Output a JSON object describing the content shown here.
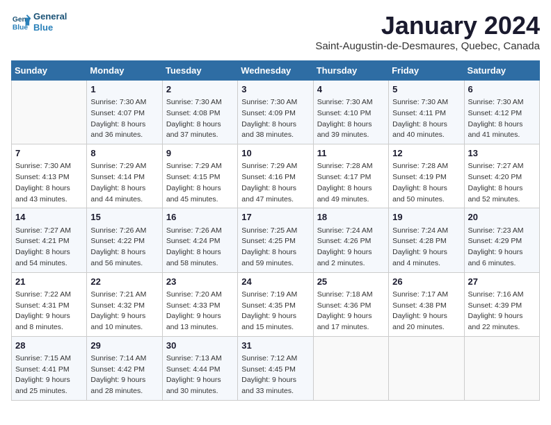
{
  "header": {
    "logo_line1": "General",
    "logo_line2": "Blue",
    "title": "January 2024",
    "subtitle": "Saint-Augustin-de-Desmaures, Quebec, Canada"
  },
  "columns": [
    "Sunday",
    "Monday",
    "Tuesday",
    "Wednesday",
    "Thursday",
    "Friday",
    "Saturday"
  ],
  "weeks": [
    [
      {
        "day": "",
        "sunrise": "",
        "sunset": "",
        "daylight": ""
      },
      {
        "day": "1",
        "sunrise": "Sunrise: 7:30 AM",
        "sunset": "Sunset: 4:07 PM",
        "daylight": "Daylight: 8 hours and 36 minutes."
      },
      {
        "day": "2",
        "sunrise": "Sunrise: 7:30 AM",
        "sunset": "Sunset: 4:08 PM",
        "daylight": "Daylight: 8 hours and 37 minutes."
      },
      {
        "day": "3",
        "sunrise": "Sunrise: 7:30 AM",
        "sunset": "Sunset: 4:09 PM",
        "daylight": "Daylight: 8 hours and 38 minutes."
      },
      {
        "day": "4",
        "sunrise": "Sunrise: 7:30 AM",
        "sunset": "Sunset: 4:10 PM",
        "daylight": "Daylight: 8 hours and 39 minutes."
      },
      {
        "day": "5",
        "sunrise": "Sunrise: 7:30 AM",
        "sunset": "Sunset: 4:11 PM",
        "daylight": "Daylight: 8 hours and 40 minutes."
      },
      {
        "day": "6",
        "sunrise": "Sunrise: 7:30 AM",
        "sunset": "Sunset: 4:12 PM",
        "daylight": "Daylight: 8 hours and 41 minutes."
      }
    ],
    [
      {
        "day": "7",
        "sunrise": "Sunrise: 7:30 AM",
        "sunset": "Sunset: 4:13 PM",
        "daylight": "Daylight: 8 hours and 43 minutes."
      },
      {
        "day": "8",
        "sunrise": "Sunrise: 7:29 AM",
        "sunset": "Sunset: 4:14 PM",
        "daylight": "Daylight: 8 hours and 44 minutes."
      },
      {
        "day": "9",
        "sunrise": "Sunrise: 7:29 AM",
        "sunset": "Sunset: 4:15 PM",
        "daylight": "Daylight: 8 hours and 45 minutes."
      },
      {
        "day": "10",
        "sunrise": "Sunrise: 7:29 AM",
        "sunset": "Sunset: 4:16 PM",
        "daylight": "Daylight: 8 hours and 47 minutes."
      },
      {
        "day": "11",
        "sunrise": "Sunrise: 7:28 AM",
        "sunset": "Sunset: 4:17 PM",
        "daylight": "Daylight: 8 hours and 49 minutes."
      },
      {
        "day": "12",
        "sunrise": "Sunrise: 7:28 AM",
        "sunset": "Sunset: 4:19 PM",
        "daylight": "Daylight: 8 hours and 50 minutes."
      },
      {
        "day": "13",
        "sunrise": "Sunrise: 7:27 AM",
        "sunset": "Sunset: 4:20 PM",
        "daylight": "Daylight: 8 hours and 52 minutes."
      }
    ],
    [
      {
        "day": "14",
        "sunrise": "Sunrise: 7:27 AM",
        "sunset": "Sunset: 4:21 PM",
        "daylight": "Daylight: 8 hours and 54 minutes."
      },
      {
        "day": "15",
        "sunrise": "Sunrise: 7:26 AM",
        "sunset": "Sunset: 4:22 PM",
        "daylight": "Daylight: 8 hours and 56 minutes."
      },
      {
        "day": "16",
        "sunrise": "Sunrise: 7:26 AM",
        "sunset": "Sunset: 4:24 PM",
        "daylight": "Daylight: 8 hours and 58 minutes."
      },
      {
        "day": "17",
        "sunrise": "Sunrise: 7:25 AM",
        "sunset": "Sunset: 4:25 PM",
        "daylight": "Daylight: 8 hours and 59 minutes."
      },
      {
        "day": "18",
        "sunrise": "Sunrise: 7:24 AM",
        "sunset": "Sunset: 4:26 PM",
        "daylight": "Daylight: 9 hours and 2 minutes."
      },
      {
        "day": "19",
        "sunrise": "Sunrise: 7:24 AM",
        "sunset": "Sunset: 4:28 PM",
        "daylight": "Daylight: 9 hours and 4 minutes."
      },
      {
        "day": "20",
        "sunrise": "Sunrise: 7:23 AM",
        "sunset": "Sunset: 4:29 PM",
        "daylight": "Daylight: 9 hours and 6 minutes."
      }
    ],
    [
      {
        "day": "21",
        "sunrise": "Sunrise: 7:22 AM",
        "sunset": "Sunset: 4:31 PM",
        "daylight": "Daylight: 9 hours and 8 minutes."
      },
      {
        "day": "22",
        "sunrise": "Sunrise: 7:21 AM",
        "sunset": "Sunset: 4:32 PM",
        "daylight": "Daylight: 9 hours and 10 minutes."
      },
      {
        "day": "23",
        "sunrise": "Sunrise: 7:20 AM",
        "sunset": "Sunset: 4:33 PM",
        "daylight": "Daylight: 9 hours and 13 minutes."
      },
      {
        "day": "24",
        "sunrise": "Sunrise: 7:19 AM",
        "sunset": "Sunset: 4:35 PM",
        "daylight": "Daylight: 9 hours and 15 minutes."
      },
      {
        "day": "25",
        "sunrise": "Sunrise: 7:18 AM",
        "sunset": "Sunset: 4:36 PM",
        "daylight": "Daylight: 9 hours and 17 minutes."
      },
      {
        "day": "26",
        "sunrise": "Sunrise: 7:17 AM",
        "sunset": "Sunset: 4:38 PM",
        "daylight": "Daylight: 9 hours and 20 minutes."
      },
      {
        "day": "27",
        "sunrise": "Sunrise: 7:16 AM",
        "sunset": "Sunset: 4:39 PM",
        "daylight": "Daylight: 9 hours and 22 minutes."
      }
    ],
    [
      {
        "day": "28",
        "sunrise": "Sunrise: 7:15 AM",
        "sunset": "Sunset: 4:41 PM",
        "daylight": "Daylight: 9 hours and 25 minutes."
      },
      {
        "day": "29",
        "sunrise": "Sunrise: 7:14 AM",
        "sunset": "Sunset: 4:42 PM",
        "daylight": "Daylight: 9 hours and 28 minutes."
      },
      {
        "day": "30",
        "sunrise": "Sunrise: 7:13 AM",
        "sunset": "Sunset: 4:44 PM",
        "daylight": "Daylight: 9 hours and 30 minutes."
      },
      {
        "day": "31",
        "sunrise": "Sunrise: 7:12 AM",
        "sunset": "Sunset: 4:45 PM",
        "daylight": "Daylight: 9 hours and 33 minutes."
      },
      {
        "day": "",
        "sunrise": "",
        "sunset": "",
        "daylight": ""
      },
      {
        "day": "",
        "sunrise": "",
        "sunset": "",
        "daylight": ""
      },
      {
        "day": "",
        "sunrise": "",
        "sunset": "",
        "daylight": ""
      }
    ]
  ]
}
